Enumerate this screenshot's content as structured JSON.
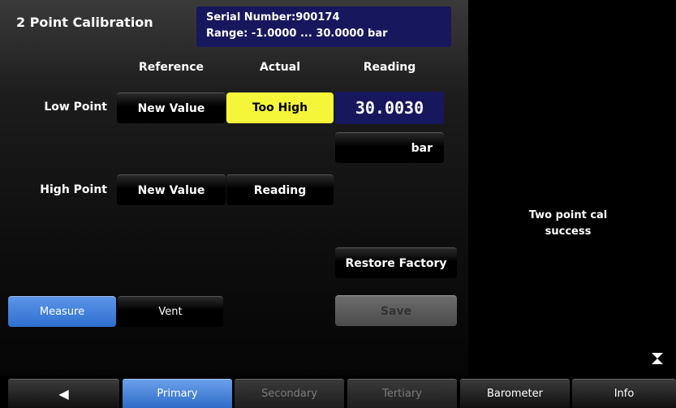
{
  "header": {
    "title": "2 Point Calibration",
    "serial_line": "Serial Number:900174",
    "range_line": "Range: -1.0000 ... 30.0000 bar"
  },
  "columns": {
    "reference": "Reference",
    "actual": "Actual",
    "reading": "Reading"
  },
  "low_point": {
    "label": "Low Point",
    "reference_button": "New Value",
    "actual_button": "Too High",
    "reading_value": "30.0030"
  },
  "unit": "bar",
  "high_point": {
    "label": "High Point",
    "reference_button": "New Value",
    "actual_button": "Reading"
  },
  "actions": {
    "restore_factory": "Restore Factory",
    "save": "Save",
    "measure": "Measure",
    "vent": "Vent"
  },
  "status": {
    "line1": "Two point cal",
    "line2": "success"
  },
  "tabs": {
    "back_icon": "◀",
    "primary": "Primary",
    "secondary": "Secondary",
    "tertiary": "Tertiary",
    "barometer": "Barometer",
    "info": "Info"
  },
  "icons": {
    "back": "back-arrow-icon",
    "expand": "collapse-expand-icon"
  },
  "colors": {
    "navy_box": "#17175e",
    "yellow_highlight": "#f5f53a",
    "active_blue": "#2e6cc9"
  }
}
